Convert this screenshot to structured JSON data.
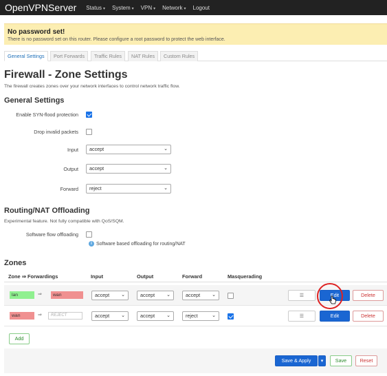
{
  "topbar": {
    "brand": "OpenVPNServer",
    "nav": [
      "Status",
      "System",
      "VPN",
      "Network",
      "Logout"
    ]
  },
  "alert": {
    "title": "No password set!",
    "text": "There is no password set on this router. Please configure a root password to protect the web interface."
  },
  "tabs": [
    "General Settings",
    "Port Forwards",
    "Traffic Rules",
    "NAT Rules",
    "Custom Rules"
  ],
  "page": {
    "title": "Firewall - Zone Settings",
    "description": "The firewall creates zones over your network interfaces to control network traffic flow."
  },
  "general": {
    "title": "General Settings",
    "syn_label": "Enable SYN-flood protection",
    "syn_checked": true,
    "drop_label": "Drop invalid packets",
    "drop_checked": false,
    "input_label": "Input",
    "input_value": "accept",
    "output_label": "Output",
    "output_value": "accept",
    "forward_label": "Forward",
    "forward_value": "reject"
  },
  "offload": {
    "title": "Routing/NAT Offloading",
    "description": "Experimental feature. Not fully compatible with QoS/SQM.",
    "flow_label": "Software flow offloading",
    "flow_checked": false,
    "help": "Software based offloading for routing/NAT"
  },
  "zones": {
    "title": "Zones",
    "headers": {
      "zone": "Zone ⇒ Forwardings",
      "input": "Input",
      "output": "Output",
      "forward": "Forward",
      "masq": "Masquerading"
    },
    "rows": [
      {
        "zone": "lan",
        "target": "wan",
        "input": "accept",
        "output": "accept",
        "forward": "accept",
        "masq": false
      },
      {
        "zone": "wan",
        "target": "REJECT",
        "input": "accept",
        "output": "accept",
        "forward": "reject",
        "masq": true
      }
    ],
    "arrow": "⇒",
    "menu_label": "☰",
    "edit_label": "Edit",
    "delete_label": "Delete",
    "add_label": "Add"
  },
  "footer": {
    "save_apply": "Save & Apply",
    "save": "Save",
    "reset": "Reset"
  },
  "colors": {
    "accent": "#1a66d2",
    "lan": "#90f090",
    "wan": "#f09090",
    "alert_bg": "#fceeb2"
  }
}
